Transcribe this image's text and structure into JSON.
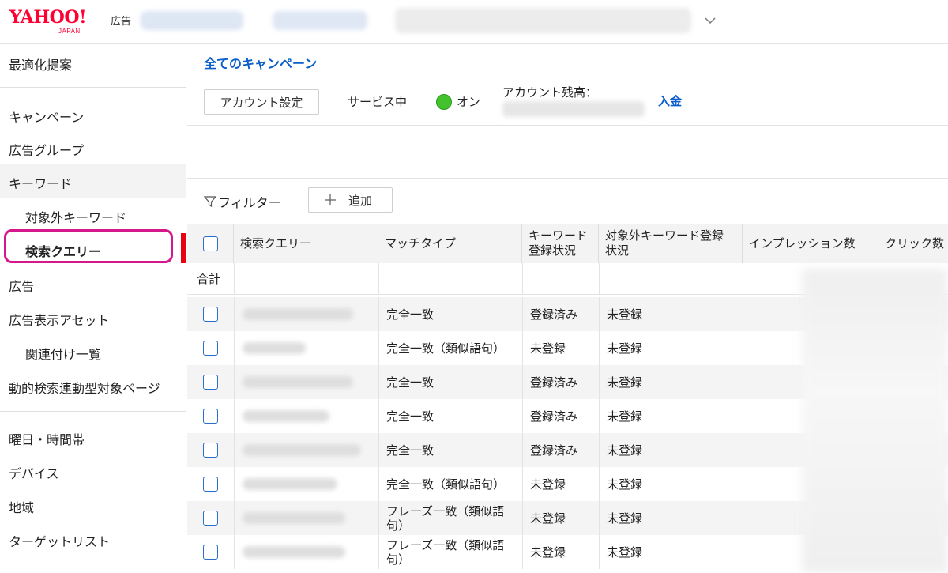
{
  "header": {
    "logo_text": "YAHOO!",
    "logo_sub": "JAPAN",
    "product": "広告"
  },
  "sidebar": {
    "items": [
      {
        "label": "最適化提案"
      },
      {
        "label": "キャンペーン"
      },
      {
        "label": "広告グループ"
      },
      {
        "label": "キーワード"
      },
      {
        "label": "対象外キーワード"
      },
      {
        "label": "検索クエリー"
      },
      {
        "label": "広告"
      },
      {
        "label": "広告表示アセット"
      },
      {
        "label": "関連付け一覧"
      },
      {
        "label": "動的検索連動型対象ページ"
      },
      {
        "label": "曜日・時間帯"
      },
      {
        "label": "デバイス"
      },
      {
        "label": "地域"
      },
      {
        "label": "ターゲットリスト"
      }
    ]
  },
  "main": {
    "breadcrumb": "全てのキャンペーン",
    "account_settings": "アカウント設定",
    "service_label": "サービス中",
    "status_on": "オン",
    "balance_label": "アカウント残高：",
    "deposit_link": "入金",
    "filter_label": "フィルター",
    "add_label": "追加"
  },
  "table": {
    "headers": [
      "検索クエリー",
      "マッチタイプ",
      "キーワード登録状況",
      "対象外キーワード登録状況",
      "インプレッション数",
      "クリック数"
    ],
    "headers_wrapped": {
      "kw_line1": "キーワード",
      "kw_line2": "登録状況",
      "neg_line1": "対象外キーワード登録",
      "neg_line2": "状況"
    },
    "total_label": "合計",
    "rows": [
      {
        "match": "完全一致",
        "kw": "登録済み",
        "neg": "未登録"
      },
      {
        "match": "完全一致（類似語句）",
        "kw": "未登録",
        "neg": "未登録"
      },
      {
        "match": "完全一致",
        "kw": "登録済み",
        "neg": "未登録"
      },
      {
        "match": "完全一致",
        "kw": "登録済み",
        "neg": "未登録"
      },
      {
        "match": "完全一致",
        "kw": "登録済み",
        "neg": "未登録"
      },
      {
        "match": "完全一致（類似語句）",
        "kw": "未登録",
        "neg": "未登録"
      },
      {
        "match_line1": "フレーズ一致（類似語",
        "match_line2": "句）",
        "kw": "未登録",
        "neg": "未登録"
      },
      {
        "match_line1": "フレーズ一致（類似語",
        "match_line2": "句）",
        "kw": "未登録",
        "neg": "未登録"
      }
    ]
  },
  "colors": {
    "brand": "#ff0033",
    "link": "#0a5ecc",
    "status_on": "#43c22e",
    "highlight": "#d4178a",
    "selected_indicator": "#e60012"
  }
}
